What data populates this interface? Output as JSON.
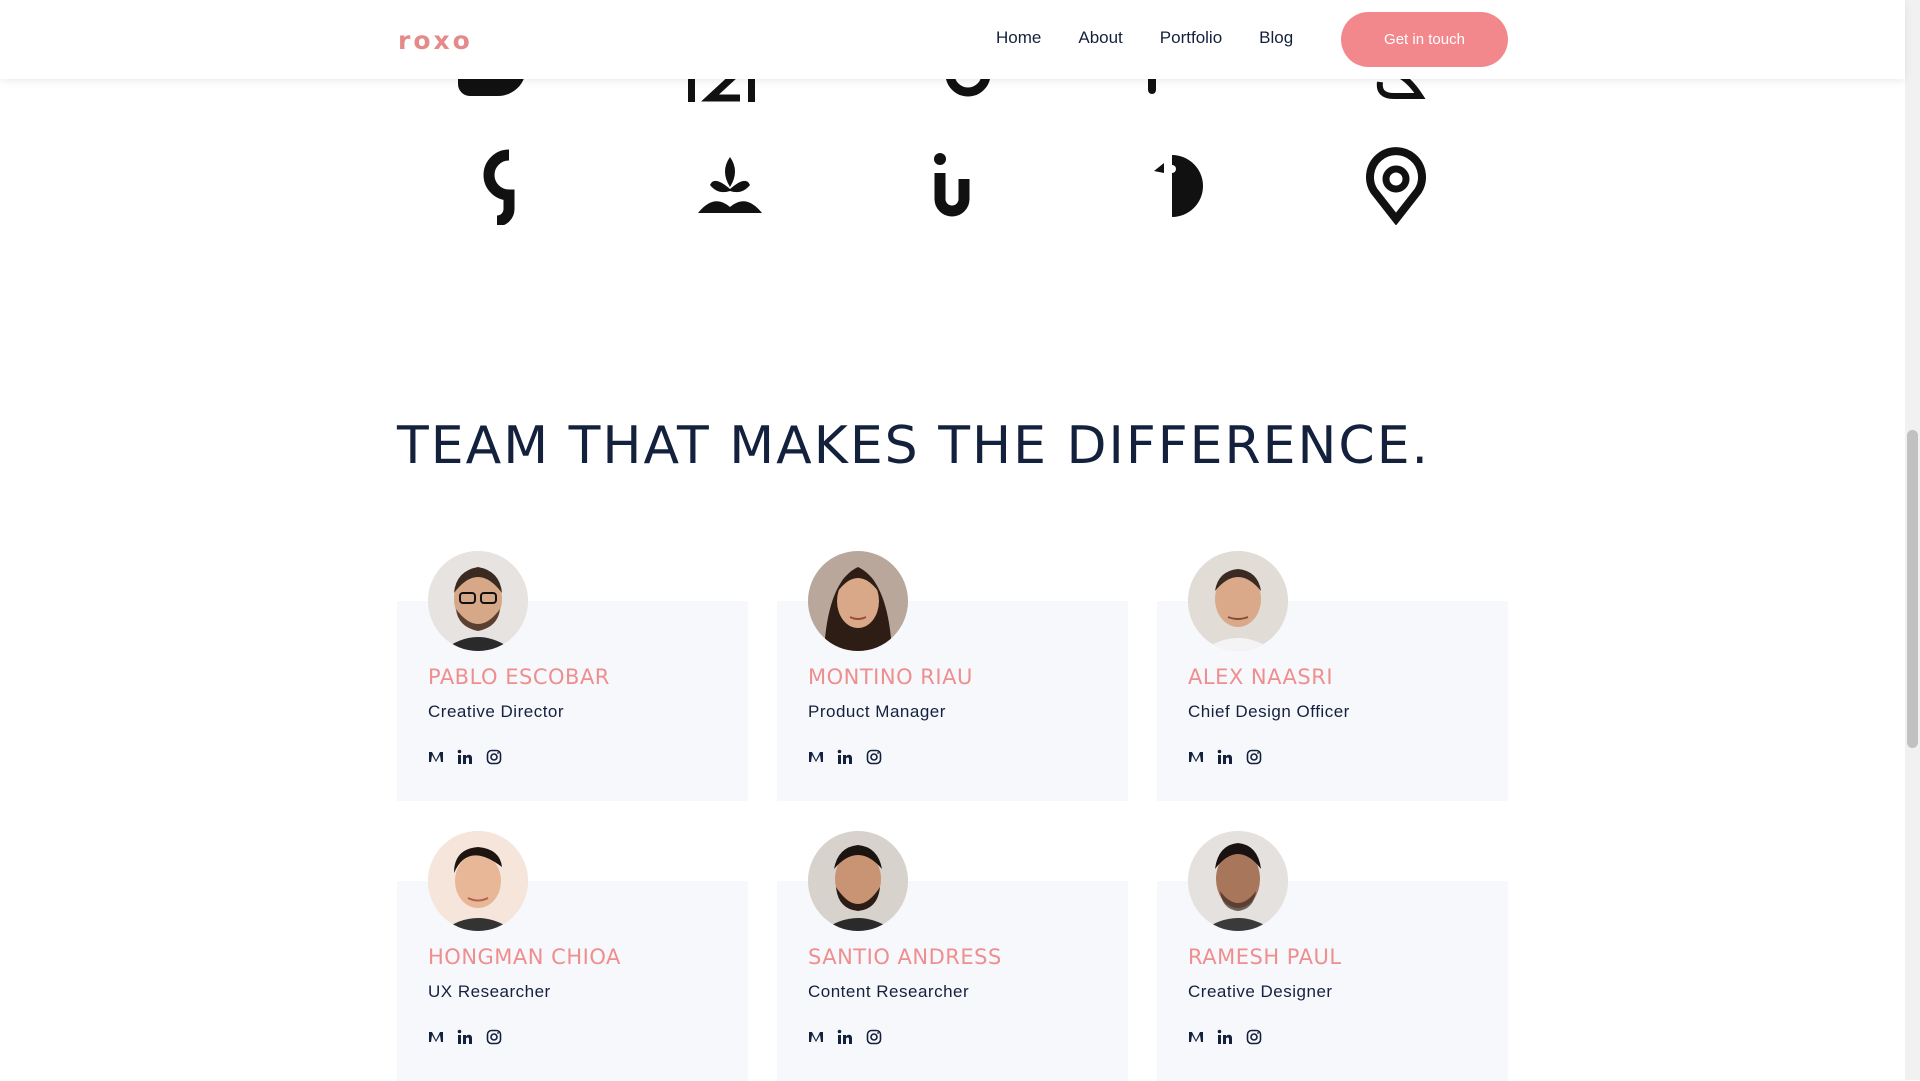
{
  "header": {
    "logo_text": "roxo",
    "nav": [
      {
        "label": "Home"
      },
      {
        "label": "About"
      },
      {
        "label": "Portfolio"
      },
      {
        "label": "Blog"
      }
    ],
    "cta_label": "Get in touch",
    "accent_color": "#f2888b"
  },
  "logos": {
    "row1": [
      "d-shape-icon",
      "twenty-one-icon",
      "ring-icon",
      "bar-icon",
      "leaf-icon"
    ],
    "row2": [
      "g-letter-icon",
      "lotus-icon",
      "u-letter-icon",
      "bird-icon",
      "location-pin-icon"
    ]
  },
  "team": {
    "title": "TEAM THAT MAKES THE DIFFERENCE.",
    "members": [
      {
        "name": "PABLO ESCOBAR",
        "role": "Creative Director"
      },
      {
        "name": "MONTINO RIAU",
        "role": "Product Manager"
      },
      {
        "name": "ALEX NAASRI",
        "role": "Chief Design Officer"
      },
      {
        "name": "HONGMAN CHIOA",
        "role": "UX Researcher"
      },
      {
        "name": "SANTIO ANDRESS",
        "role": "Content Researcher"
      },
      {
        "name": "RAMESH PAUL",
        "role": "Creative Designer"
      }
    ],
    "social_icons": [
      "medium-icon",
      "linkedin-icon",
      "instagram-icon"
    ]
  },
  "colors": {
    "name_color": "#ee8e8e",
    "text_color": "#14213d",
    "card_bg": "#f7f8fc"
  }
}
